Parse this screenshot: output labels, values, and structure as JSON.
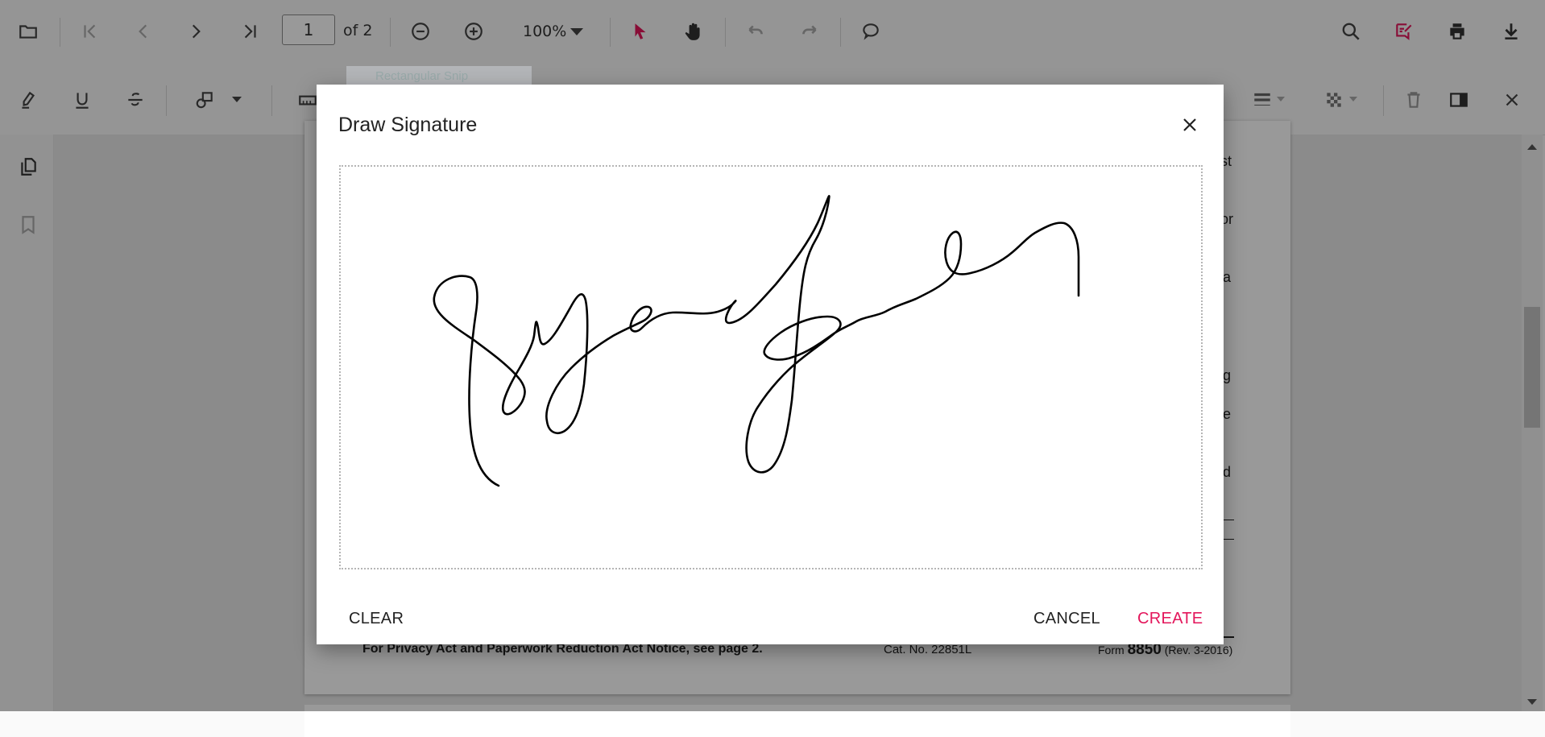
{
  "toolbar": {
    "page_number": "1",
    "page_count": "of 2",
    "zoom_level": "100%",
    "icons": [
      "open-file-icon",
      "first-page-icon",
      "previous-page-icon",
      "next-page-icon",
      "last-page-icon",
      "zoom-out-icon",
      "zoom-in-icon",
      "select-tool-icon",
      "pan-tool-icon",
      "undo-icon",
      "redo-icon",
      "comment-icon",
      "search-icon",
      "annotation-edit-icon",
      "print-icon",
      "download-icon"
    ]
  },
  "annotation_toolbar": {
    "icons": [
      "highlight-icon",
      "underline-icon",
      "strikethrough-icon",
      "shapes-icon",
      "measure-icon",
      "stroke-thickness-icon",
      "opacity-icon",
      "delete-icon",
      "comment-panel-icon",
      "close-icon"
    ]
  },
  "sidebar": {
    "icons": [
      "page-thumbnails-icon",
      "bookmarks-icon"
    ]
  },
  "overlay_label": "Rectangular Snip",
  "document": {
    "line_fragments": [
      "st",
      "or",
      "a",
      "g",
      "e",
      "d"
    ],
    "footer_left": "For Privacy Act and Paperwork Reduction Act Notice, see page 2.",
    "footer_center": "Cat. No. 22851L",
    "footer_right_prefix": "Form",
    "footer_right_form": "8850",
    "footer_right_suffix": "(Rev. 3-2016)"
  },
  "dialog": {
    "title": "Draw Signature",
    "clear_label": "CLEAR",
    "cancel_label": "CANCEL",
    "create_label": "CREATE",
    "signature_stroke_color": "#000000"
  },
  "colors": {
    "accent": "#e3165b"
  }
}
